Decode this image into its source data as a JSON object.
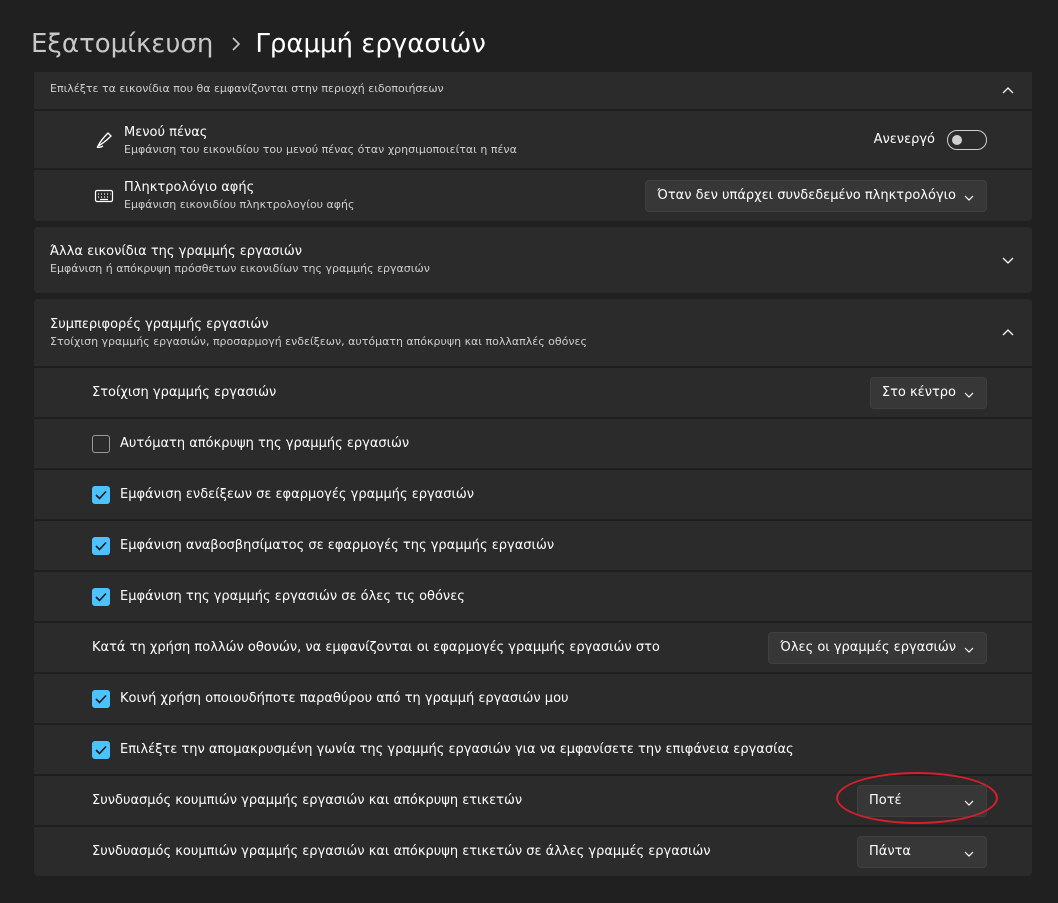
{
  "breadcrumb": {
    "parent": "Εξατομίκευση",
    "current": "Γραμμή εργασιών"
  },
  "notification_icons": {
    "subtitle": "Επιλέξτε τα εικονίδια που θα εμφανίζονται στην περιοχή ειδοποιήσεων",
    "pen_menu": {
      "icon": "pen-icon",
      "title": "Μενού πένας",
      "subtitle": "Εμφάνιση του εικονιδίου του μενού πένας όταν χρησιμοποιείται η πένα",
      "state": "Ανενεργό"
    },
    "touch_keyboard": {
      "icon": "keyboard-icon",
      "title": "Πληκτρολόγιο αφής",
      "subtitle": "Εμφάνιση εικονιδίου πληκτρολογίου αφής",
      "value": "Όταν δεν υπάρχει συνδεδεμένο πληκτρολόγιο"
    }
  },
  "other_icons": {
    "title": "Άλλα εικονίδια της γραμμής εργασιών",
    "subtitle": "Εμφάνιση ή απόκρυψη πρόσθετων εικονιδίων της γραμμής εργασιών"
  },
  "behaviors": {
    "title": "Συμπεριφορές γραμμής εργασιών",
    "subtitle": "Στοίχιση γραμμής εργασιών, προσαρμογή ενδείξεων, αυτόματη απόκρυψη και πολλαπλές οθόνες",
    "alignment_label": "Στοίχιση γραμμής εργασιών",
    "alignment_value": "Στο κέντρο",
    "auto_hide": {
      "label": "Αυτόματη απόκρυψη της γραμμής εργασιών",
      "checked": false
    },
    "badges": {
      "label": "Εμφάνιση ενδείξεων σε εφαρμογές γραμμής εργασιών",
      "checked": true
    },
    "flashing": {
      "label": "Εμφάνιση αναβοσβησίματος σε εφαρμογές της γραμμής εργασιών",
      "checked": true
    },
    "all_displays": {
      "label": "Εμφάνιση της γραμμής εργασιών σε όλες τις οθόνες",
      "checked": true
    },
    "multi_display_label": "Κατά τη χρήση πολλών οθονών, να εμφανίζονται οι εφαρμογές γραμμής εργασιών στο",
    "multi_display_value": "Όλες οι γραμμές εργασιών",
    "share_window": {
      "label": "Κοινή χρήση οποιουδήποτε παραθύρου από τη γραμμή εργασιών μου",
      "checked": true
    },
    "far_corner": {
      "label": "Επιλέξτε την απομακρυσμένη γωνία της γραμμής εργασιών για να εμφανίσετε την επιφάνεια εργασίας",
      "checked": true
    },
    "combine_label": "Συνδυασμός κουμπιών γραμμής εργασιών και απόκρυψη ετικετών",
    "combine_value": "Ποτέ",
    "combine_other_label": "Συνδυασμός κουμπιών γραμμής εργασιών και απόκρυψη ετικετών σε άλλες γραμμές εργασιών",
    "combine_other_value": "Πάντα"
  },
  "colors": {
    "accent": "#4cc2ff",
    "highlight": "#d3202a"
  }
}
